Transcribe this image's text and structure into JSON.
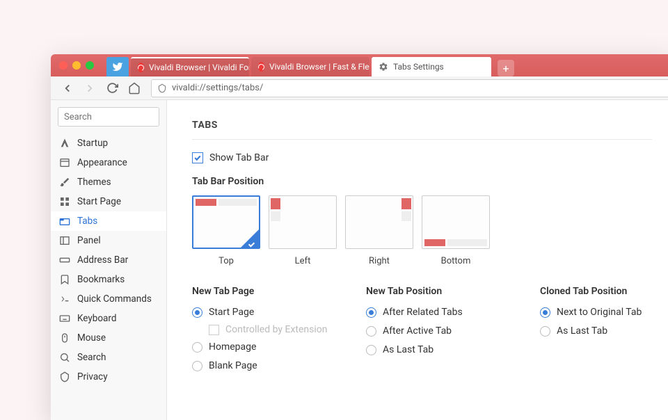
{
  "tabs": [
    {
      "label": "",
      "type": "pinned"
    },
    {
      "label": "Vivaldi Browser | Vivaldi Forum"
    },
    {
      "label": "Vivaldi Browser | Fast & Flexible"
    },
    {
      "label": "Tabs Settings",
      "active": true
    }
  ],
  "url": "vivaldi://settings/tabs/",
  "search_placeholder": "Search",
  "sidebar": {
    "items": [
      {
        "label": "Startup"
      },
      {
        "label": "Appearance"
      },
      {
        "label": "Themes"
      },
      {
        "label": "Start Page"
      },
      {
        "label": "Tabs",
        "active": true
      },
      {
        "label": "Panel"
      },
      {
        "label": "Address Bar"
      },
      {
        "label": "Bookmarks"
      },
      {
        "label": "Quick Commands"
      },
      {
        "label": "Keyboard"
      },
      {
        "label": "Mouse"
      },
      {
        "label": "Search"
      },
      {
        "label": "Privacy"
      }
    ]
  },
  "settings": {
    "title": "TABS",
    "show_tab_bar": {
      "label": "Show Tab Bar",
      "checked": true
    },
    "position": {
      "title": "Tab Bar Position",
      "options": [
        "Top",
        "Left",
        "Right",
        "Bottom"
      ],
      "selected": "Top"
    },
    "new_tab_page": {
      "title": "New Tab Page",
      "options": [
        "Start Page",
        "Homepage",
        "Blank Page"
      ],
      "selected": "Start Page",
      "extension_note": "Controlled by Extension"
    },
    "new_tab_position": {
      "title": "New Tab Position",
      "options": [
        "After Related Tabs",
        "After Active Tab",
        "As Last Tab"
      ],
      "selected": "After Related Tabs"
    },
    "cloned_tab_position": {
      "title": "Cloned Tab Position",
      "options": [
        "Next to Original Tab",
        "As Last Tab"
      ],
      "selected": "Next to Original Tab"
    }
  }
}
